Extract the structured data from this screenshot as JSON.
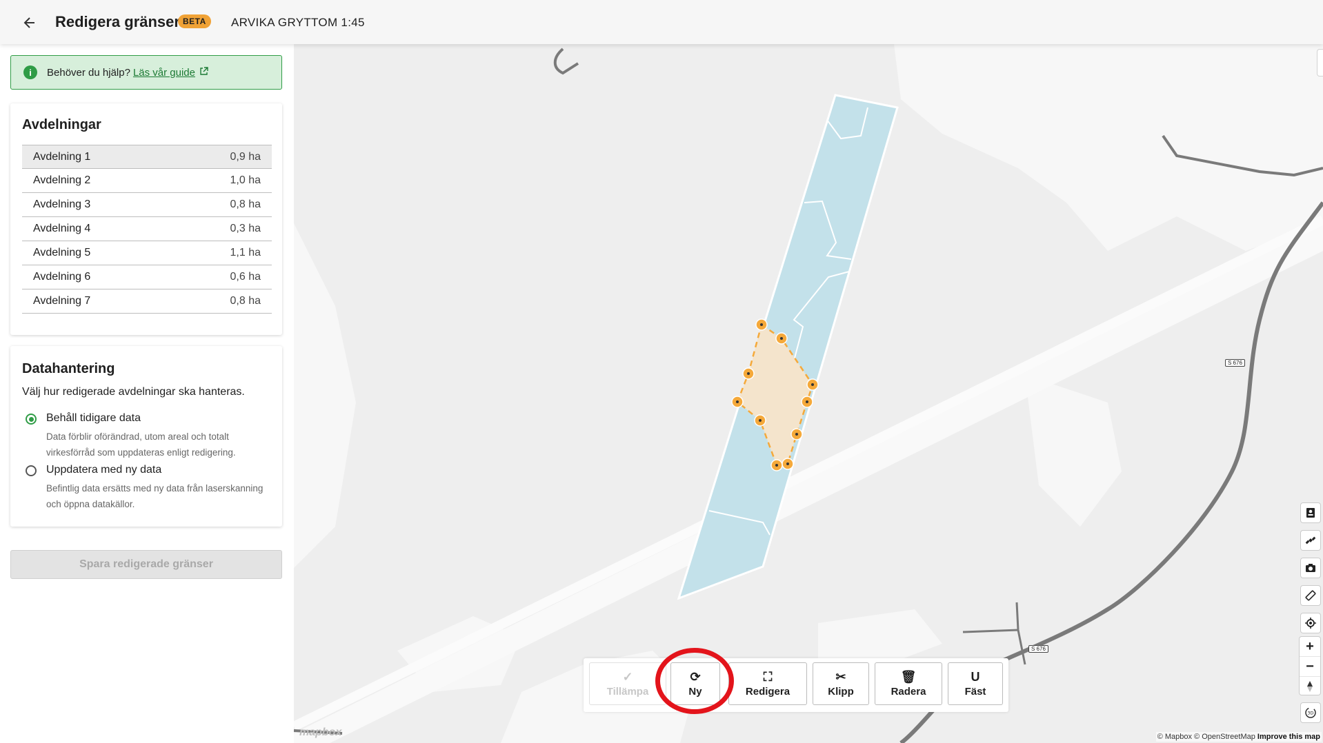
{
  "header": {
    "title": "Redigera gränser",
    "badge": "BETA",
    "property": "ARVIKA GRYTTOM 1:45"
  },
  "help": {
    "text": "Behöver du hjälp?",
    "link": "Läs vår guide"
  },
  "avdelningar": {
    "title": "Avdelningar",
    "items": [
      {
        "name": "Avdelning 1",
        "area": "0,9 ha"
      },
      {
        "name": "Avdelning 2",
        "area": "1,0 ha"
      },
      {
        "name": "Avdelning 3",
        "area": "0,8 ha"
      },
      {
        "name": "Avdelning 4",
        "area": "0,3 ha"
      },
      {
        "name": "Avdelning 5",
        "area": "1,1 ha"
      },
      {
        "name": "Avdelning 6",
        "area": "0,6 ha"
      },
      {
        "name": "Avdelning 7",
        "area": "0,8 ha"
      }
    ]
  },
  "datahantering": {
    "title": "Datahantering",
    "description": "Välj hur redigerade avdelningar ska hanteras.",
    "options": [
      {
        "label": "Behåll tidigare data",
        "help": "Data förblir oförändrad, utom areal och totalt virkesförråd som uppdateras enligt redigering.",
        "checked": true
      },
      {
        "label": "Uppdatera med ny data",
        "help": "Befintlig data ersätts med ny data från laserskanning och öppna datakällor.",
        "checked": false
      }
    ]
  },
  "save_button": "Spara redigerade gränser",
  "toolbar": {
    "apply": "Tillämpa",
    "new": "Ny",
    "edit": "Redigera",
    "cut": "Klipp",
    "delete": "Radera",
    "snap": "Fäst"
  },
  "map": {
    "road_labels": [
      "S 676",
      "S 676"
    ],
    "attribution": "© Mapbox © OpenStreetMap",
    "improve": "Improve this map",
    "logo": "mapbox",
    "colors": {
      "parcel": "#c3e1ea",
      "selection_fill": "#f4e4cc",
      "vertex": "#f5a93a",
      "road": "#7a7a7a",
      "highlight": "#e3141b"
    }
  }
}
